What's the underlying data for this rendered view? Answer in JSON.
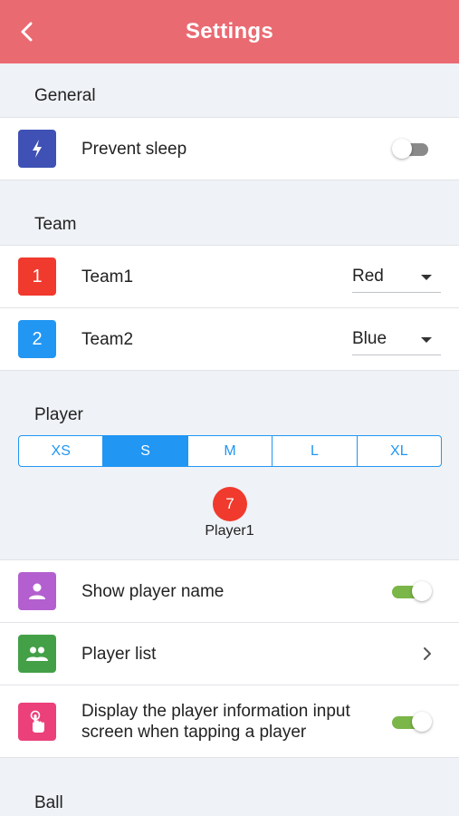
{
  "header": {
    "title": "Settings",
    "back_icon": "chevron-left-icon"
  },
  "general": {
    "label": "General",
    "prevent_sleep": {
      "label": "Prevent sleep",
      "icon": "bolt-icon",
      "icon_color": "#3f51b5",
      "on": false
    }
  },
  "team": {
    "label": "Team",
    "items": [
      {
        "number": "1",
        "label": "Team1",
        "color_value": "Red",
        "badge_color": "#f03a2e"
      },
      {
        "number": "2",
        "label": "Team2",
        "color_value": "Blue",
        "badge_color": "#2196f3"
      }
    ]
  },
  "player": {
    "label": "Player",
    "sizes": [
      "XS",
      "S",
      "M",
      "L",
      "XL"
    ],
    "selected_size": "S",
    "preview": {
      "number": "7",
      "name": "Player1",
      "badge_color": "#f03a2e"
    },
    "show_name": {
      "label": "Show player name",
      "icon": "person-icon",
      "icon_color": "#b35fcf",
      "on": true
    },
    "list": {
      "label": "Player list",
      "icon": "group-icon",
      "icon_color": "#43a047"
    },
    "info_input": {
      "label": "Display the player information input screen when tapping a player",
      "icon": "tap-icon",
      "icon_color": "#ec407a",
      "on": true
    }
  },
  "ball": {
    "label": "Ball"
  },
  "colors": {
    "header": "#ea6a72",
    "accent": "#2196f3",
    "toggle_on": "#7ab648",
    "background": "#eff2f6"
  }
}
